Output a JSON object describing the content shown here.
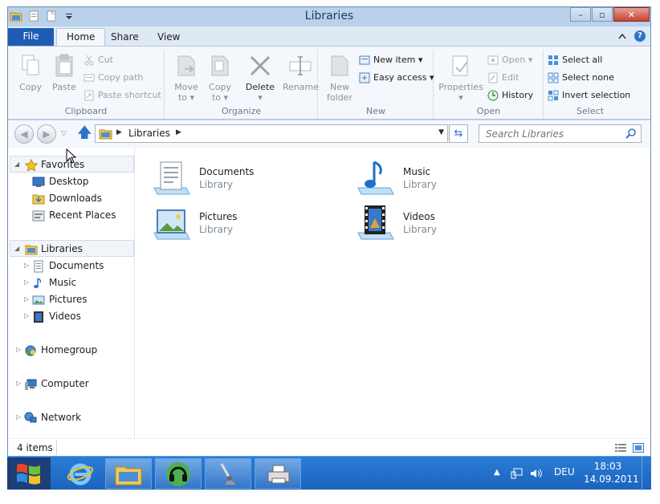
{
  "window": {
    "title": "Libraries",
    "controls": {
      "minimize": "–",
      "maximize": "▫",
      "close": "✕"
    }
  },
  "ribbon_tabs": {
    "file": "File",
    "home": "Home",
    "share": "Share",
    "view": "View",
    "help": "?"
  },
  "ribbon": {
    "clipboard": {
      "label": "Clipboard",
      "copy": "Copy",
      "paste": "Paste",
      "cut": "Cut",
      "copy_path": "Copy path",
      "paste_shortcut": "Paste shortcut"
    },
    "organize": {
      "label": "Organize",
      "move_to": "Move",
      "move_to_2": "to ▾",
      "copy_to": "Copy",
      "copy_to_2": "to ▾",
      "delete": "Delete",
      "delete_2": "▾",
      "rename": "Rename"
    },
    "new": {
      "label": "New",
      "new_folder": "New",
      "new_folder_2": "folder",
      "new_item": "New item ▾",
      "easy_access": "Easy access ▾"
    },
    "open": {
      "label": "Open",
      "properties": "Properties",
      "properties_2": "▾",
      "open": "Open ▾",
      "edit": "Edit",
      "history": "History"
    },
    "select": {
      "label": "Select",
      "select_all": "Select all",
      "select_none": "Select none",
      "invert_selection": "Invert selection"
    }
  },
  "address_bar": {
    "back": "◀",
    "forward": "▶",
    "recent": "▽",
    "up": "🡅",
    "arrow_1": "▶",
    "path": "Libraries",
    "arrow_2": "▶",
    "dropdown": "▼",
    "refresh": "⇆",
    "search_placeholder": "Search Libraries"
  },
  "nav_pane": {
    "favorites": "Favorites",
    "desktop": "Desktop",
    "downloads": "Downloads",
    "recent_places": "Recent Places",
    "libraries": "Libraries",
    "documents": "Documents",
    "music": "Music",
    "pictures": "Pictures",
    "videos": "Videos",
    "homegroup": "Homegroup",
    "computer": "Computer",
    "network": "Network",
    "expanded_glyph": "◢",
    "collapsed_glyph": "▷"
  },
  "files": [
    {
      "name": "Documents",
      "type": "Library"
    },
    {
      "name": "Music",
      "type": "Library"
    },
    {
      "name": "Pictures",
      "type": "Library"
    },
    {
      "name": "Videos",
      "type": "Library"
    }
  ],
  "status": {
    "items": "4 items"
  },
  "taskbar": {
    "tray_arrow": "▲",
    "language": "DEU",
    "time": "18:03",
    "date": "14.09.2011"
  },
  "icons": {
    "qat": [
      "folder-icon",
      "properties-icon",
      "new-folder-icon",
      "customize-icon"
    ],
    "clipboard": [
      "copy-icon",
      "paste-icon",
      "cut-icon",
      "copy-path-icon",
      "paste-shortcut-icon"
    ],
    "organize": [
      "move-to-icon",
      "copy-to-icon",
      "delete-icon",
      "rename-icon"
    ],
    "new": [
      "new-folder-icon",
      "new-item-icon",
      "easy-access-icon"
    ],
    "open": [
      "properties-icon",
      "open-icon",
      "edit-icon",
      "history-icon"
    ],
    "select": [
      "select-all-icon",
      "select-none-icon",
      "invert-selection-icon"
    ],
    "nav": [
      "star-icon",
      "desktop-icon",
      "downloads-icon",
      "recent-places-icon",
      "libraries-icon",
      "documents-icon",
      "music-icon",
      "pictures-icon",
      "videos-icon",
      "homegroup-icon",
      "computer-icon",
      "network-icon"
    ],
    "taskbar": [
      "windows-logo-icon",
      "internet-explorer-icon",
      "explorer-icon",
      "media-player-icon",
      "paint-icon",
      "printer-icon",
      "network-tray-icon",
      "volume-icon"
    ]
  },
  "colors": {
    "title_bar": "#b9d1ea",
    "file_tab": "#1e5db3",
    "accent_blue": "#2f73c9",
    "close_button": "#c74232",
    "taskbar": "#1c63bd",
    "disabled_text": "#9aa3aa",
    "secondary_text": "#7d8a97"
  }
}
